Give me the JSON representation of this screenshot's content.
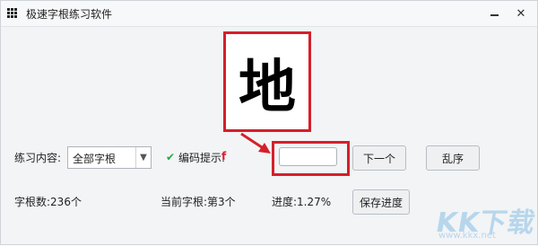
{
  "window": {
    "title": "极速字根练习软件",
    "min_glyph": "—",
    "close_glyph": "✕"
  },
  "current_char": "地",
  "practice": {
    "label": "练习内容:",
    "selected": "全部字根",
    "dropdown_glyph": "▼"
  },
  "hint": {
    "check_glyph": "✔",
    "label": "编码提示:",
    "value": "f"
  },
  "input": {
    "value": ""
  },
  "buttons": {
    "next": "下一个",
    "shuffle": "乱序",
    "save": "保存进度"
  },
  "stats": {
    "total": "字根数:236个",
    "current": "当前字根:第3个",
    "progress": "进度:1.27%"
  },
  "watermark": {
    "brand": "KK下载",
    "url": "www.kkx.net"
  },
  "colors": {
    "highlight_red": "#d51f2b",
    "check_green": "#27a745"
  }
}
